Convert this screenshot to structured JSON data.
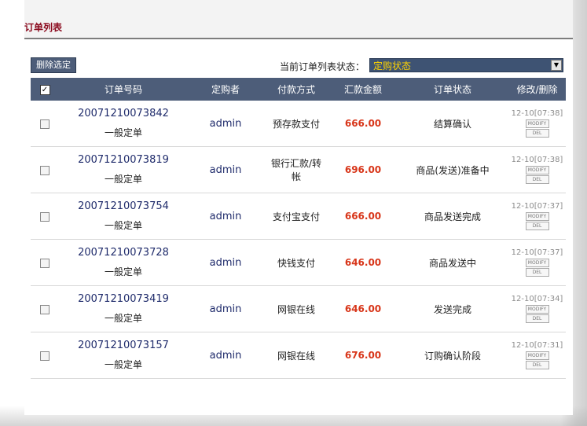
{
  "panel": {
    "title": "订单列表",
    "delete_button": "删除选定",
    "filter_label": "当前订单列表状态：",
    "filter_selected": "定购状态"
  },
  "table": {
    "headers": [
      "订单号码",
      "定购者",
      "付款方式",
      "汇款金额",
      "订单状态",
      "修改/删除"
    ],
    "modify_label": "MODIFY",
    "del_label": "DEL",
    "rows": [
      {
        "order_no": "20071210073842",
        "type": "一般定单",
        "buyer": "admin",
        "payment": "预存款支付",
        "amount": "666.00",
        "status": "结算确认",
        "time": "12-10[07:38]"
      },
      {
        "order_no": "20071210073819",
        "type": "一般定单",
        "buyer": "admin",
        "payment": "银行汇款/转帐",
        "amount": "696.00",
        "status": "商品(发送)准备中",
        "time": "12-10[07:38]"
      },
      {
        "order_no": "20071210073754",
        "type": "一般定单",
        "buyer": "admin",
        "payment": "支付宝支付",
        "amount": "666.00",
        "status": "商品发送完成",
        "time": "12-10[07:37]"
      },
      {
        "order_no": "20071210073728",
        "type": "一般定单",
        "buyer": "admin",
        "payment": "快钱支付",
        "amount": "646.00",
        "status": "商品发送中",
        "time": "12-10[07:37]"
      },
      {
        "order_no": "20071210073419",
        "type": "一般定单",
        "buyer": "admin",
        "payment": "网银在线",
        "amount": "646.00",
        "status": "发送完成",
        "time": "12-10[07:34]"
      },
      {
        "order_no": "20071210073157",
        "type": "一般定单",
        "buyer": "admin",
        "payment": "网银在线",
        "amount": "676.00",
        "status": "订购确认阶段",
        "time": "12-10[07:31]"
      }
    ]
  },
  "colors": {
    "title": "#8b0a1e",
    "header_bg": "#4d5d79",
    "amount": "#d8361a",
    "select_text": "#ffd400"
  }
}
